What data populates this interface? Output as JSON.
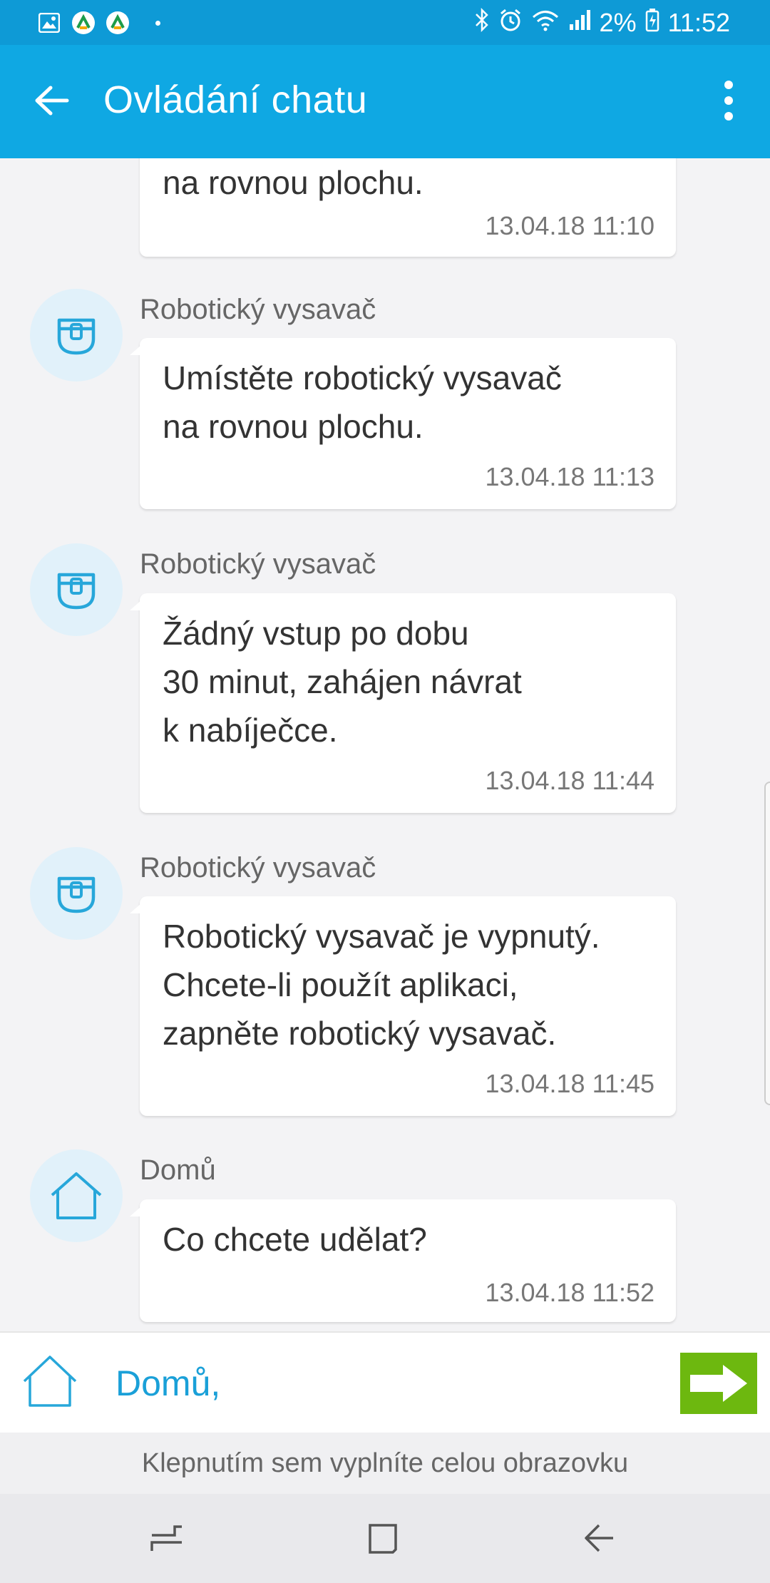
{
  "status_bar": {
    "battery": "2%",
    "time": "11:52",
    "icons": [
      "gallery-icon",
      "app-icon",
      "app-icon",
      "bluetooth-icon",
      "alarm-icon",
      "wifi-icon",
      "signal-icon",
      "battery-icon"
    ]
  },
  "app_bar": {
    "title": "Ovládání chatu",
    "back_icon": "back-arrow-icon",
    "menu_icon": "more-vert-icon"
  },
  "messages": [
    {
      "sender": "",
      "text": "na rovnou plochu.",
      "time": "13.04.18 11:10",
      "avatar": ""
    },
    {
      "sender": "Robotický vysavač",
      "text": "Umístěte robotický vysavač\nna rovnou plochu.",
      "time": "13.04.18 11:13",
      "avatar": "robot-vacuum-icon"
    },
    {
      "sender": "Robotický vysavač",
      "text": "Žádný vstup po dobu\n30 minut, zahájen návrat\nk nabíječce.",
      "time": "13.04.18 11:44",
      "avatar": "robot-vacuum-icon"
    },
    {
      "sender": "Robotický vysavač",
      "text": "Robotický vysavač je vypnutý.\nChcete-li použít aplikaci,\nzapněte robotický vysavač.",
      "time": "13.04.18 11:45",
      "avatar": "robot-vacuum-icon"
    },
    {
      "sender": "Domů",
      "text": "Co chcete udělat?",
      "time": "13.04.18 11:52",
      "avatar": "home-icon"
    }
  ],
  "input": {
    "value": "Domů,",
    "icon": "home-icon",
    "send_icon": "arrow-right-icon"
  },
  "expand_hint": "Klepnutím sem vyplníte celou obrazovku",
  "nav_bar": {
    "buttons": [
      "recents-icon",
      "home-square-icon",
      "back-icon"
    ]
  },
  "colors": {
    "status_bar": "#0e9ad6",
    "app_bar": "#0fa8e3",
    "accent": "#1aa0d8",
    "send_button": "#6db80f",
    "avatar_bg": "#e1f1fa"
  }
}
